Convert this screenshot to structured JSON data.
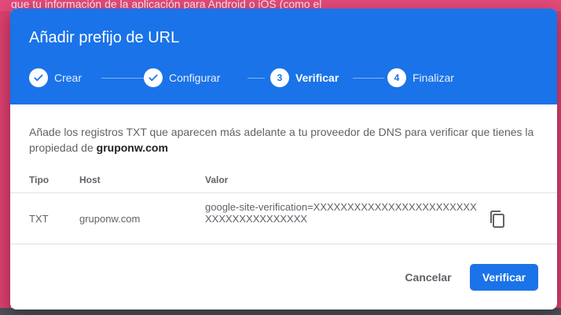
{
  "background": {
    "partial_text": "que tu información de la aplicación para Android o iOS (como el"
  },
  "dialog": {
    "title": "Añadir prefijo de URL",
    "steps": [
      {
        "label": "Crear",
        "status": "done",
        "icon": "check-icon"
      },
      {
        "label": "Configurar",
        "status": "done",
        "icon": "check-icon"
      },
      {
        "label": "Verificar",
        "status": "active",
        "number": "3"
      },
      {
        "label": "Finalizar",
        "status": "pending",
        "number": "4"
      }
    ],
    "intro_text": "Añade los registros TXT que aparecen más adelante a tu proveedor de DNS para verificar que tienes la propiedad de ",
    "intro_domain": "gruponw.com",
    "table": {
      "headers": {
        "type": "Tipo",
        "host": "Host",
        "value": "Valor"
      },
      "rows": [
        {
          "type": "TXT",
          "host": "gruponw.com",
          "value": "google-site-verification=XXXXXXXXXXXXXXXXXXXXXXXXXXXXXXXXXXXXXXX",
          "copy_icon": "copy-icon"
        }
      ]
    },
    "buttons": {
      "cancel": "Cancelar",
      "verify": "Verificar"
    }
  },
  "colors": {
    "primary": "#1a73e8",
    "background_accent": "#e24a7a"
  }
}
